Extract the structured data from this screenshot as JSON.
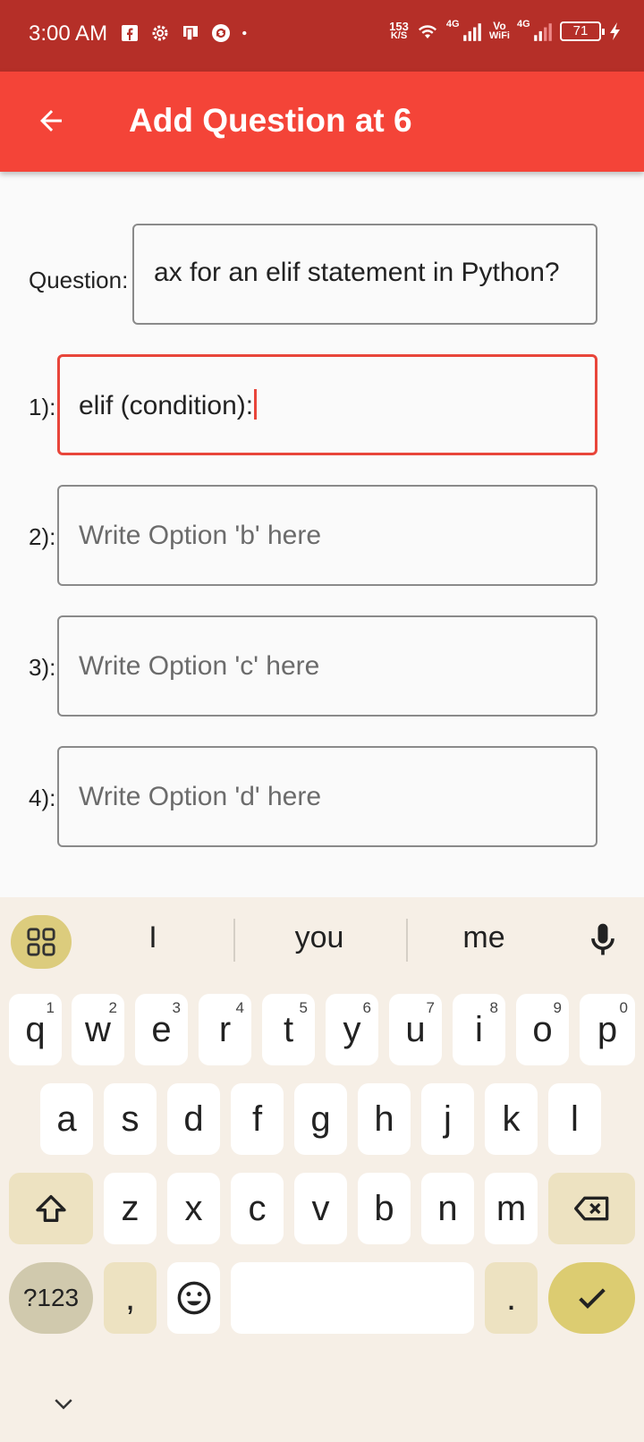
{
  "status_bar": {
    "time": "3:00 AM",
    "speed_value": "153",
    "speed_unit": "K/S",
    "net1": "4G",
    "vo": "Vo",
    "wifi": "WiFi",
    "net2": "4G",
    "battery": "71",
    "icons": [
      "facebook-icon",
      "gear-icon",
      "screen-icon",
      "sync-icon",
      "dot-icon",
      "wifi-icon",
      "signal-icon",
      "signal-icon",
      "battery-icon",
      "charging-icon"
    ]
  },
  "app_bar": {
    "title": "Add Question at 6",
    "back_icon": "arrow-back-icon"
  },
  "form": {
    "question_label": "Question:",
    "question_value": "ax for an elif statement in Python?",
    "options": [
      {
        "label": "1):",
        "value": "elif (condition):",
        "placeholder": ""
      },
      {
        "label": "2):",
        "value": "",
        "placeholder": "Write Option 'b' here"
      },
      {
        "label": "3):",
        "value": "",
        "placeholder": "Write Option 'c' here"
      },
      {
        "label": "4):",
        "value": "",
        "placeholder": "Write Option 'd' here"
      }
    ]
  },
  "keyboard": {
    "suggestions": [
      "I",
      "you",
      "me"
    ],
    "row1": [
      [
        "q",
        "1"
      ],
      [
        "w",
        "2"
      ],
      [
        "e",
        "3"
      ],
      [
        "r",
        "4"
      ],
      [
        "t",
        "5"
      ],
      [
        "y",
        "6"
      ],
      [
        "u",
        "7"
      ],
      [
        "i",
        "8"
      ],
      [
        "o",
        "9"
      ],
      [
        "p",
        "0"
      ]
    ],
    "row2": [
      "a",
      "s",
      "d",
      "f",
      "g",
      "h",
      "j",
      "k",
      "l"
    ],
    "row3": [
      "z",
      "x",
      "c",
      "v",
      "b",
      "n",
      "m"
    ],
    "sym_label": "?123",
    "comma": ",",
    "period": ".",
    "accent": "#dccc71"
  },
  "colors": {
    "status_bar": "#b52f28",
    "app_bar": "#f44438",
    "focus_border": "#e8453a"
  }
}
